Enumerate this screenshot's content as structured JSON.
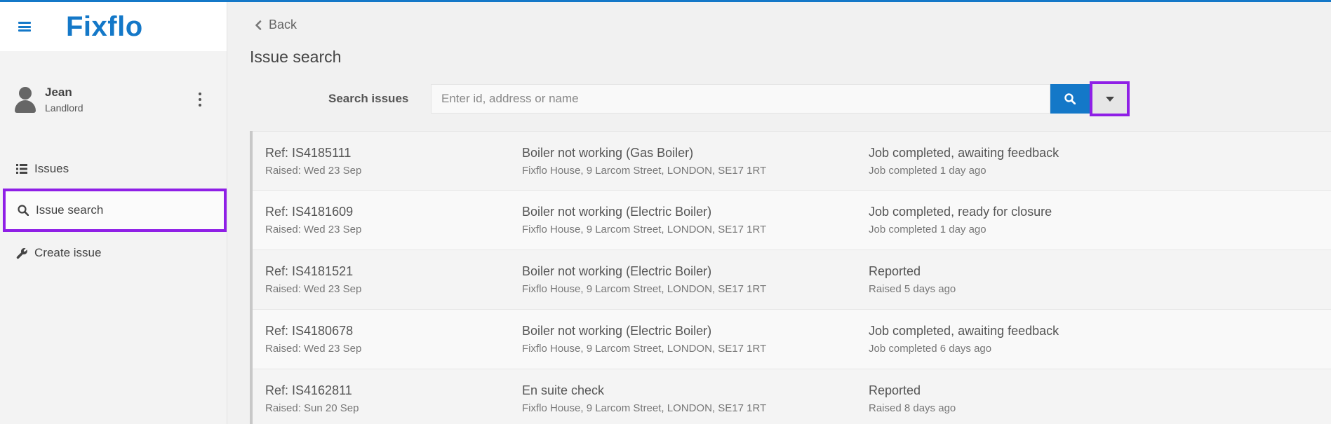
{
  "app": {
    "logo": "Fixflo"
  },
  "user": {
    "name": "Jean",
    "role": "Landlord"
  },
  "nav": {
    "issues": "Issues",
    "issue_search": "Issue search",
    "create_issue": "Create issue"
  },
  "main": {
    "back": "Back",
    "title": "Issue search",
    "search_label": "Search issues",
    "search_placeholder": "Enter id, address or name"
  },
  "results": [
    {
      "ref": "Ref: IS4185111",
      "raised": "Raised: Wed 23 Sep",
      "title": "Boiler not working (Gas Boiler)",
      "address": "Fixflo House, 9 Larcom Street, LONDON, SE17 1RT",
      "status": "Job completed, awaiting feedback",
      "status_detail": "Job completed 1 day ago"
    },
    {
      "ref": "Ref: IS4181609",
      "raised": "Raised: Wed 23 Sep",
      "title": "Boiler not working (Electric Boiler)",
      "address": "Fixflo House, 9 Larcom Street, LONDON, SE17 1RT",
      "status": "Job completed, ready for closure",
      "status_detail": "Job completed 1 day ago"
    },
    {
      "ref": "Ref: IS4181521",
      "raised": "Raised: Wed 23 Sep",
      "title": "Boiler not working (Electric Boiler)",
      "address": "Fixflo House, 9 Larcom Street, LONDON, SE17 1RT",
      "status": "Reported",
      "status_detail": "Raised 5 days ago"
    },
    {
      "ref": "Ref: IS4180678",
      "raised": "Raised: Wed 23 Sep",
      "title": "Boiler not working (Electric Boiler)",
      "address": "Fixflo House, 9 Larcom Street, LONDON, SE17 1RT",
      "status": "Job completed, awaiting feedback",
      "status_detail": "Job completed 6 days ago"
    },
    {
      "ref": "Ref: IS4162811",
      "raised": "Raised: Sun 20 Sep",
      "title": "En suite check",
      "address": "Fixflo House, 9 Larcom Street, LONDON, SE17 1RT",
      "status": "Reported",
      "status_detail": "Raised 8 days ago"
    }
  ],
  "colors": {
    "brand": "#1478c8",
    "highlight": "#8f1fe6"
  },
  "icons": [
    "hamburger-menu-icon",
    "user-avatar-icon",
    "kebab-menu-icon",
    "list-icon",
    "search-icon",
    "wrench-icon",
    "chevron-left-icon",
    "caret-down-icon"
  ]
}
